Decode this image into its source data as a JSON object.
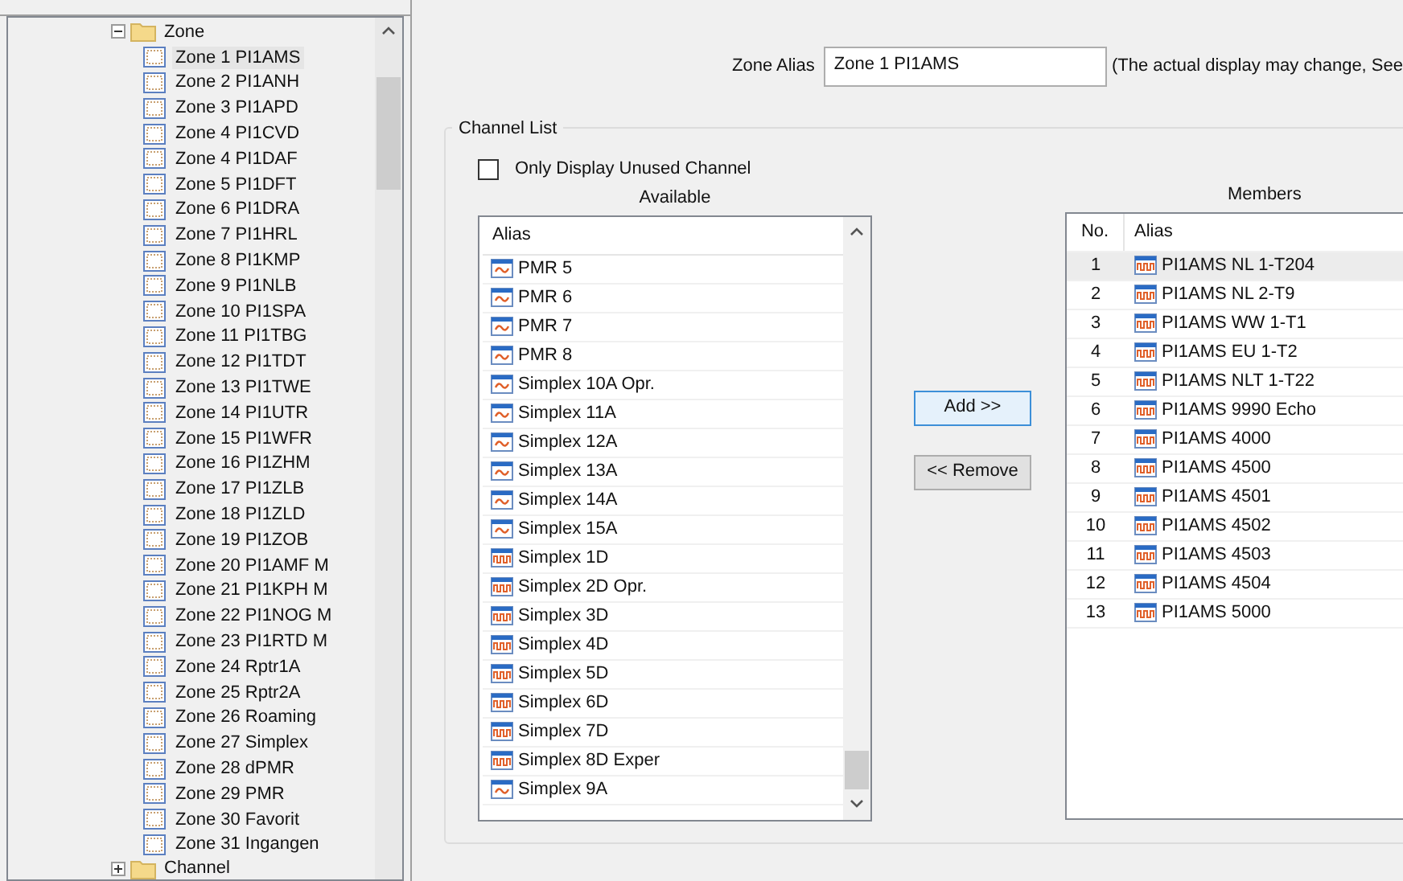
{
  "tree": {
    "folder": {
      "label": "Zone",
      "expanded": true,
      "children": [
        {
          "label": "Zone 1 PI1AMS",
          "selected": true
        },
        {
          "label": "Zone 2 PI1ANH",
          "selected": false
        },
        {
          "label": "Zone 3 PI1APD",
          "selected": false
        },
        {
          "label": "Zone 4 PI1CVD",
          "selected": false
        },
        {
          "label": "Zone 4 PI1DAF",
          "selected": false
        },
        {
          "label": "Zone 5 PI1DFT",
          "selected": false
        },
        {
          "label": "Zone 6 PI1DRA",
          "selected": false
        },
        {
          "label": "Zone 7 PI1HRL",
          "selected": false
        },
        {
          "label": "Zone 8 PI1KMP",
          "selected": false
        },
        {
          "label": "Zone 9 PI1NLB",
          "selected": false
        },
        {
          "label": "Zone 10 PI1SPA",
          "selected": false
        },
        {
          "label": "Zone 11 PI1TBG",
          "selected": false
        },
        {
          "label": "Zone 12 PI1TDT",
          "selected": false
        },
        {
          "label": "Zone 13 PI1TWE",
          "selected": false
        },
        {
          "label": "Zone 14 PI1UTR",
          "selected": false
        },
        {
          "label": "Zone 15 PI1WFR",
          "selected": false
        },
        {
          "label": "Zone 16 PI1ZHM",
          "selected": false
        },
        {
          "label": "Zone 17 PI1ZLB",
          "selected": false
        },
        {
          "label": "Zone 18 PI1ZLD",
          "selected": false
        },
        {
          "label": "Zone 19 PI1ZOB",
          "selected": false
        },
        {
          "label": "Zone 20 PI1AMF M",
          "selected": false
        },
        {
          "label": "Zone 21 PI1KPH M",
          "selected": false
        },
        {
          "label": "Zone 22 PI1NOG M",
          "selected": false
        },
        {
          "label": "Zone 23 PI1RTD M",
          "selected": false
        },
        {
          "label": "Zone 24 Rptr1A",
          "selected": false
        },
        {
          "label": "Zone 25 Rptr2A",
          "selected": false
        },
        {
          "label": "Zone 26 Roaming",
          "selected": false
        },
        {
          "label": "Zone 27 Simplex",
          "selected": false
        },
        {
          "label": "Zone 28 dPMR",
          "selected": false
        },
        {
          "label": "Zone 29 PMR",
          "selected": false
        },
        {
          "label": "Zone 30 Favorit",
          "selected": false
        },
        {
          "label": "Zone 31 Ingangen",
          "selected": false
        }
      ]
    },
    "next_folder": {
      "label": "Channel",
      "expanded": false
    }
  },
  "zone_alias": {
    "label": "Zone Alias",
    "value": "Zone 1 PI1AMS",
    "note": "(The actual display may change, See"
  },
  "channel_list": {
    "title": "Channel List",
    "only_unused": {
      "label": "Only Display Unused Channel",
      "checked": false
    },
    "available": {
      "title": "Available",
      "column": "Alias",
      "rows": [
        {
          "alias": "PMR 5",
          "kind": "analog"
        },
        {
          "alias": "PMR 6",
          "kind": "analog"
        },
        {
          "alias": "PMR 7",
          "kind": "analog"
        },
        {
          "alias": "PMR 8",
          "kind": "analog"
        },
        {
          "alias": "Simplex 10A Opr.",
          "kind": "analog"
        },
        {
          "alias": "Simplex 11A",
          "kind": "analog"
        },
        {
          "alias": "Simplex 12A",
          "kind": "analog"
        },
        {
          "alias": "Simplex 13A",
          "kind": "analog"
        },
        {
          "alias": "Simplex 14A",
          "kind": "analog"
        },
        {
          "alias": "Simplex 15A",
          "kind": "analog"
        },
        {
          "alias": "Simplex 1D",
          "kind": "digital"
        },
        {
          "alias": "Simplex 2D Opr.",
          "kind": "digital"
        },
        {
          "alias": "Simplex 3D",
          "kind": "digital"
        },
        {
          "alias": "Simplex 4D",
          "kind": "digital"
        },
        {
          "alias": "Simplex 5D",
          "kind": "digital"
        },
        {
          "alias": "Simplex 6D",
          "kind": "digital"
        },
        {
          "alias": "Simplex 7D",
          "kind": "digital"
        },
        {
          "alias": "Simplex 8D Exper",
          "kind": "digital"
        },
        {
          "alias": "Simplex 9A",
          "kind": "analog"
        }
      ]
    },
    "buttons": [
      {
        "label": "Add >>",
        "focused": true
      },
      {
        "label": "<< Remove",
        "focused": false
      }
    ],
    "members": {
      "title": "Members",
      "columns": [
        "No.",
        "Alias"
      ],
      "rows": [
        {
          "no": "1",
          "alias": "PI1AMS NL 1-T204",
          "kind": "digital",
          "selected": true
        },
        {
          "no": "2",
          "alias": "PI1AMS NL 2-T9",
          "kind": "digital",
          "selected": false
        },
        {
          "no": "3",
          "alias": "PI1AMS WW 1-T1",
          "kind": "digital",
          "selected": false
        },
        {
          "no": "4",
          "alias": "PI1AMS EU 1-T2",
          "kind": "digital",
          "selected": false
        },
        {
          "no": "5",
          "alias": "PI1AMS NLT 1-T22",
          "kind": "digital",
          "selected": false
        },
        {
          "no": "6",
          "alias": "PI1AMS 9990 Echo",
          "kind": "digital",
          "selected": false
        },
        {
          "no": "7",
          "alias": "PI1AMS 4000",
          "kind": "digital",
          "selected": false
        },
        {
          "no": "8",
          "alias": "PI1AMS 4500",
          "kind": "digital",
          "selected": false
        },
        {
          "no": "9",
          "alias": "PI1AMS 4501",
          "kind": "digital",
          "selected": false
        },
        {
          "no": "10",
          "alias": "PI1AMS 4502",
          "kind": "digital",
          "selected": false
        },
        {
          "no": "11",
          "alias": "PI1AMS 4503",
          "kind": "digital",
          "selected": false
        },
        {
          "no": "12",
          "alias": "PI1AMS 4504",
          "kind": "digital",
          "selected": false
        },
        {
          "no": "13",
          "alias": "PI1AMS 5000",
          "kind": "digital",
          "selected": false
        }
      ]
    }
  }
}
